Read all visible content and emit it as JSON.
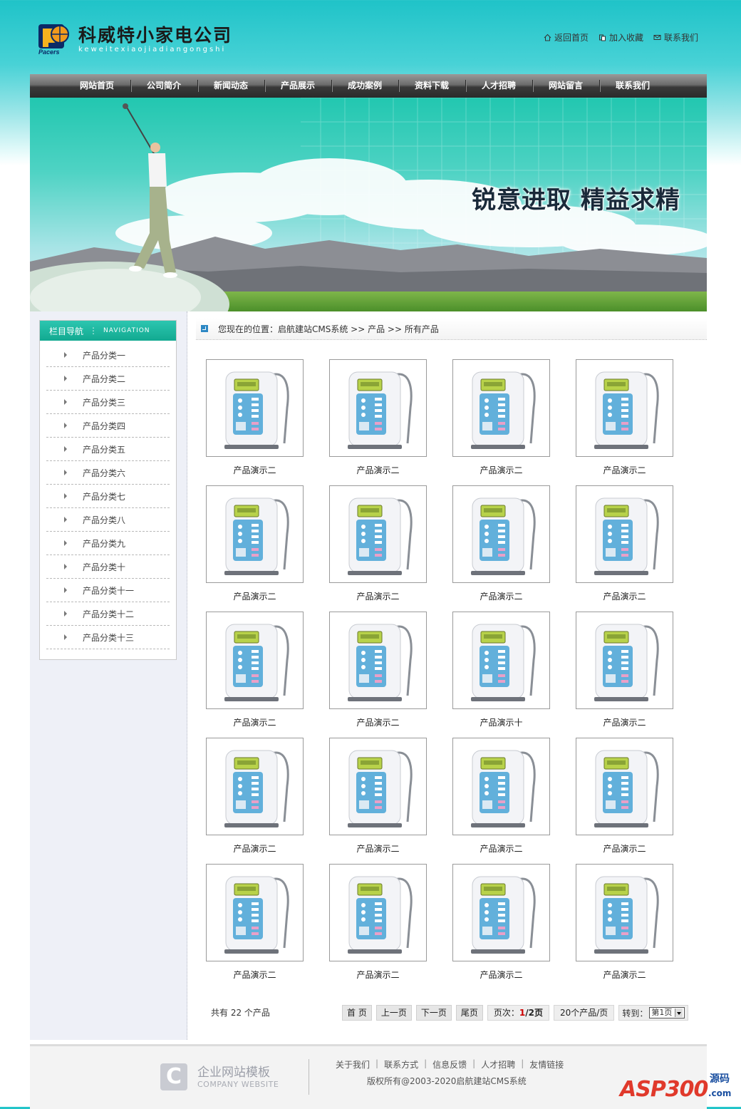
{
  "brand": {
    "title": "科威特小家电公司",
    "subtitle": "keweitexiaojiadiangongshi",
    "badge_text": "Pacers"
  },
  "toplinks": [
    {
      "label": "返回首页",
      "icon": "home-icon"
    },
    {
      "label": "加入收藏",
      "icon": "bookmark-icon"
    },
    {
      "label": "联系我们",
      "icon": "mail-icon"
    }
  ],
  "nav": [
    "网站首页",
    "公司简介",
    "新闻动态",
    "产品展示",
    "成功案例",
    "资料下载",
    "人才招聘",
    "网站留言",
    "联系我们"
  ],
  "banner": {
    "slogan": "锐意进取 精益求精"
  },
  "sidebar": {
    "title": "栏目导航",
    "title_en": "NAVIGATION",
    "items": [
      "产品分类一",
      "产品分类二",
      "产品分类三",
      "产品分类四",
      "产品分类五",
      "产品分类六",
      "产品分类七",
      "产品分类八",
      "产品分类九",
      "产品分类十",
      "产品分类十一",
      "产品分类十二",
      "产品分类十三"
    ]
  },
  "breadcrumb": "您现在的位置：启航建站CMS系统 >> 产品 >> 所有产品",
  "products": [
    "产品演示二",
    "产品演示二",
    "产品演示二",
    "产品演示二",
    "产品演示二",
    "产品演示二",
    "产品演示二",
    "产品演示二",
    "产品演示二",
    "产品演示二",
    "产品演示十",
    "产品演示二",
    "产品演示二",
    "产品演示二",
    "产品演示二",
    "产品演示二",
    "产品演示二",
    "产品演示二",
    "产品演示二",
    "产品演示二"
  ],
  "pager": {
    "total": "共有  22 个产品",
    "first": "首 页",
    "prev": "上一页",
    "next": "下一页",
    "last": "尾页",
    "page_label": "页次：",
    "current": "1",
    "total_pages": "/2页",
    "per_page": "20个产品/页",
    "jump_label": "转到：",
    "jump_value": "第1页"
  },
  "footer": {
    "logo_zh": "企业网站模板",
    "logo_en": "COMPANY WEBSITE",
    "links": [
      "关于我们",
      "联系方式",
      "信息反馈",
      "人才招聘",
      "友情链接"
    ],
    "copyright": "版权所有@2003-2020启航建站CMS系统"
  },
  "watermark": {
    "main": "ASP300",
    "zh": "源码",
    "suffix": ".com"
  },
  "colors": {
    "accent": "#12a990",
    "nav": "#3a3a3a",
    "pager_current": "#cc0000"
  }
}
